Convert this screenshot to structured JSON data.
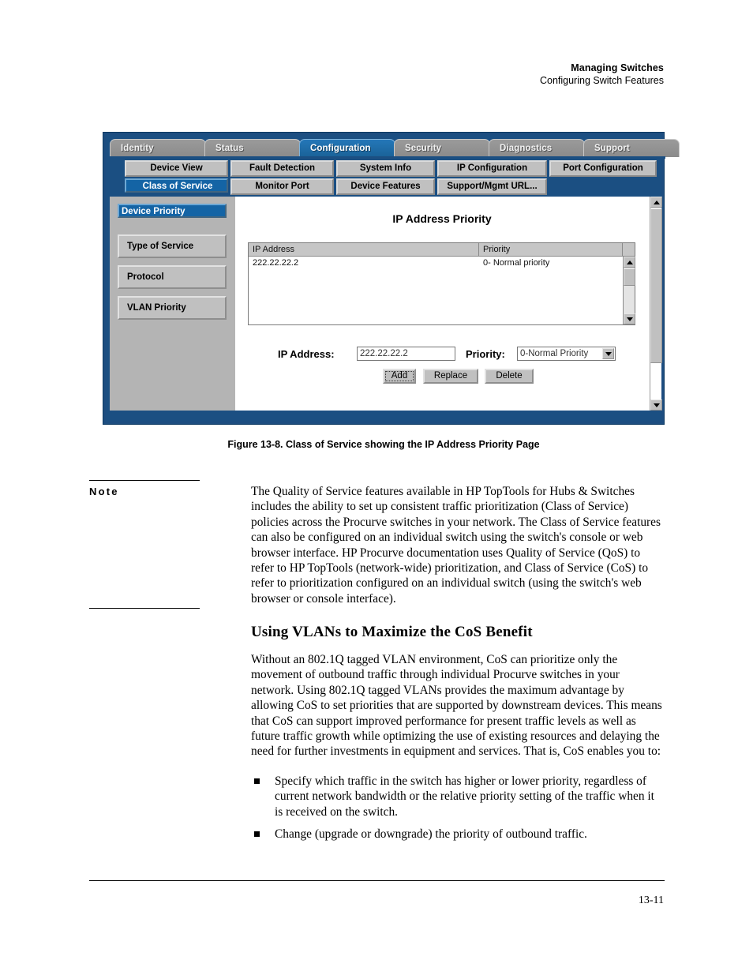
{
  "running_head": {
    "line1": "Managing Switches",
    "line2": "Configuring Switch Features"
  },
  "screenshot": {
    "tabs": [
      {
        "label": "Identity",
        "active": false
      },
      {
        "label": "Status",
        "active": false
      },
      {
        "label": "Configuration",
        "active": true
      },
      {
        "label": "Security",
        "active": false
      },
      {
        "label": "Diagnostics",
        "active": false
      },
      {
        "label": "Support",
        "active": false
      }
    ],
    "nav_row1": [
      {
        "label": "Device View",
        "selected": false
      },
      {
        "label": "Fault Detection",
        "selected": false
      },
      {
        "label": "System Info",
        "selected": false
      },
      {
        "label": "IP Configuration",
        "selected": false
      },
      {
        "label": "Port Configuration",
        "selected": false
      }
    ],
    "nav_row2": [
      {
        "label": "Class of Service",
        "selected": true
      },
      {
        "label": "Monitor Port",
        "selected": false
      },
      {
        "label": "Device Features",
        "selected": false
      },
      {
        "label": "Support/Mgmt URL...",
        "selected": false
      }
    ],
    "sidebar": [
      {
        "label": "Device Priority",
        "selected": true
      },
      {
        "label": "Type of Service",
        "selected": false
      },
      {
        "label": "Protocol",
        "selected": false
      },
      {
        "label": "VLAN Priority",
        "selected": false
      }
    ],
    "panel_title": "IP Address Priority",
    "table": {
      "columns": [
        "IP Address",
        "Priority"
      ],
      "rows": [
        {
          "ip_address": "222.22.22.2",
          "priority": "0- Normal priority"
        }
      ]
    },
    "form": {
      "ip_label": "IP Address:",
      "ip_value": "222.22.22.2",
      "priority_label": "Priority:",
      "priority_value": "0-Normal Priority"
    },
    "buttons": {
      "add": "Add",
      "replace": "Replace",
      "delete": "Delete"
    },
    "colors": {
      "frame_blue": "#1b4f82",
      "accent_blue": "#1464a5",
      "button_gray": "#c0c0c0",
      "sidebar_gray": "#b4b4b4"
    }
  },
  "caption": "Figure 13-8.  Class of Service showing the IP Address Priority Page",
  "note": {
    "label": "Note",
    "body": "The Quality of Service features available in HP TopTools for Hubs & Switches includes the ability to set up consistent traffic prioritization (Class of Service) policies across the Procurve switches in your network. The Class of Service features can also be configured on an individual switch using the switch's console or web browser interface. HP Procurve documentation uses Quality of Service (QoS) to refer to HP TopTools (network-wide) prioritization, and Class of Service (CoS) to refer to prioritization configured on an individual switch (using the switch's web browser or console interface)."
  },
  "section": {
    "heading": "Using VLANs to Maximize the CoS Benefit",
    "paragraph": "Without an 802.1Q tagged VLAN environment, CoS can prioritize only the movement of outbound traffic through individual Procurve switches in your network. Using 802.1Q tagged VLANs provides the maximum advantage by allowing CoS to set priorities that are supported by downstream devices. This means that CoS can support improved performance for present traffic levels as well as future traffic growth while optimizing the use of existing resources and delaying the need for further investments in equipment and services. That is, CoS enables you to:",
    "bullets": [
      "Specify which traffic in the switch has higher or lower priority, regardless of current network bandwidth or the relative priority setting of the traffic when it is received on the switch.",
      "Change (upgrade or downgrade) the priority of outbound traffic."
    ]
  },
  "page_number": "13-11"
}
